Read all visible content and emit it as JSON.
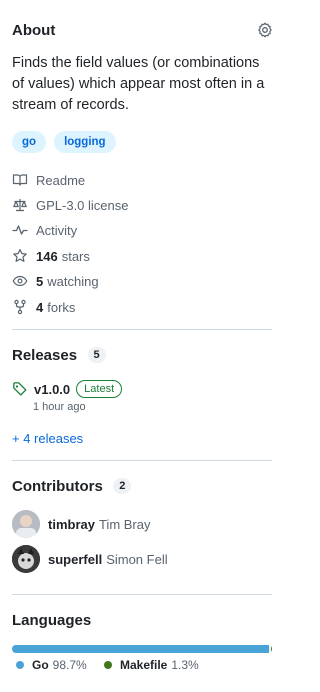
{
  "about": {
    "title": "About",
    "description": "Finds the field values (or combinations of values) which appear most often in a stream of records.",
    "tags": [
      "go",
      "logging"
    ],
    "meta": {
      "readme": "Readme",
      "license": "GPL-3.0 license",
      "activity": "Activity",
      "stars_count": "146",
      "stars_label": "stars",
      "watching_count": "5",
      "watching_label": "watching",
      "forks_count": "4",
      "forks_label": "forks"
    }
  },
  "releases": {
    "title": "Releases",
    "count": "5",
    "latest_tag": "v1.0.0",
    "latest_badge": "Latest",
    "time": "1 hour ago",
    "more_link": "+ 4 releases"
  },
  "contributors": {
    "title": "Contributors",
    "count": "2",
    "people": [
      {
        "login": "timbray",
        "name": "Tim Bray"
      },
      {
        "login": "superfell",
        "name": "Simon Fell"
      }
    ]
  },
  "languages": {
    "title": "Languages",
    "items": [
      {
        "name": "Go",
        "percent": "98.7%",
        "value": 98.7,
        "color": "#00add8"
      },
      {
        "name": "Makefile",
        "percent": "1.3%",
        "value": 1.3,
        "color": "#427819"
      }
    ]
  },
  "icons": [
    "gear-icon",
    "book-icon",
    "scale-icon",
    "pulse-icon",
    "star-icon",
    "eye-icon",
    "fork-icon",
    "tag-icon"
  ]
}
